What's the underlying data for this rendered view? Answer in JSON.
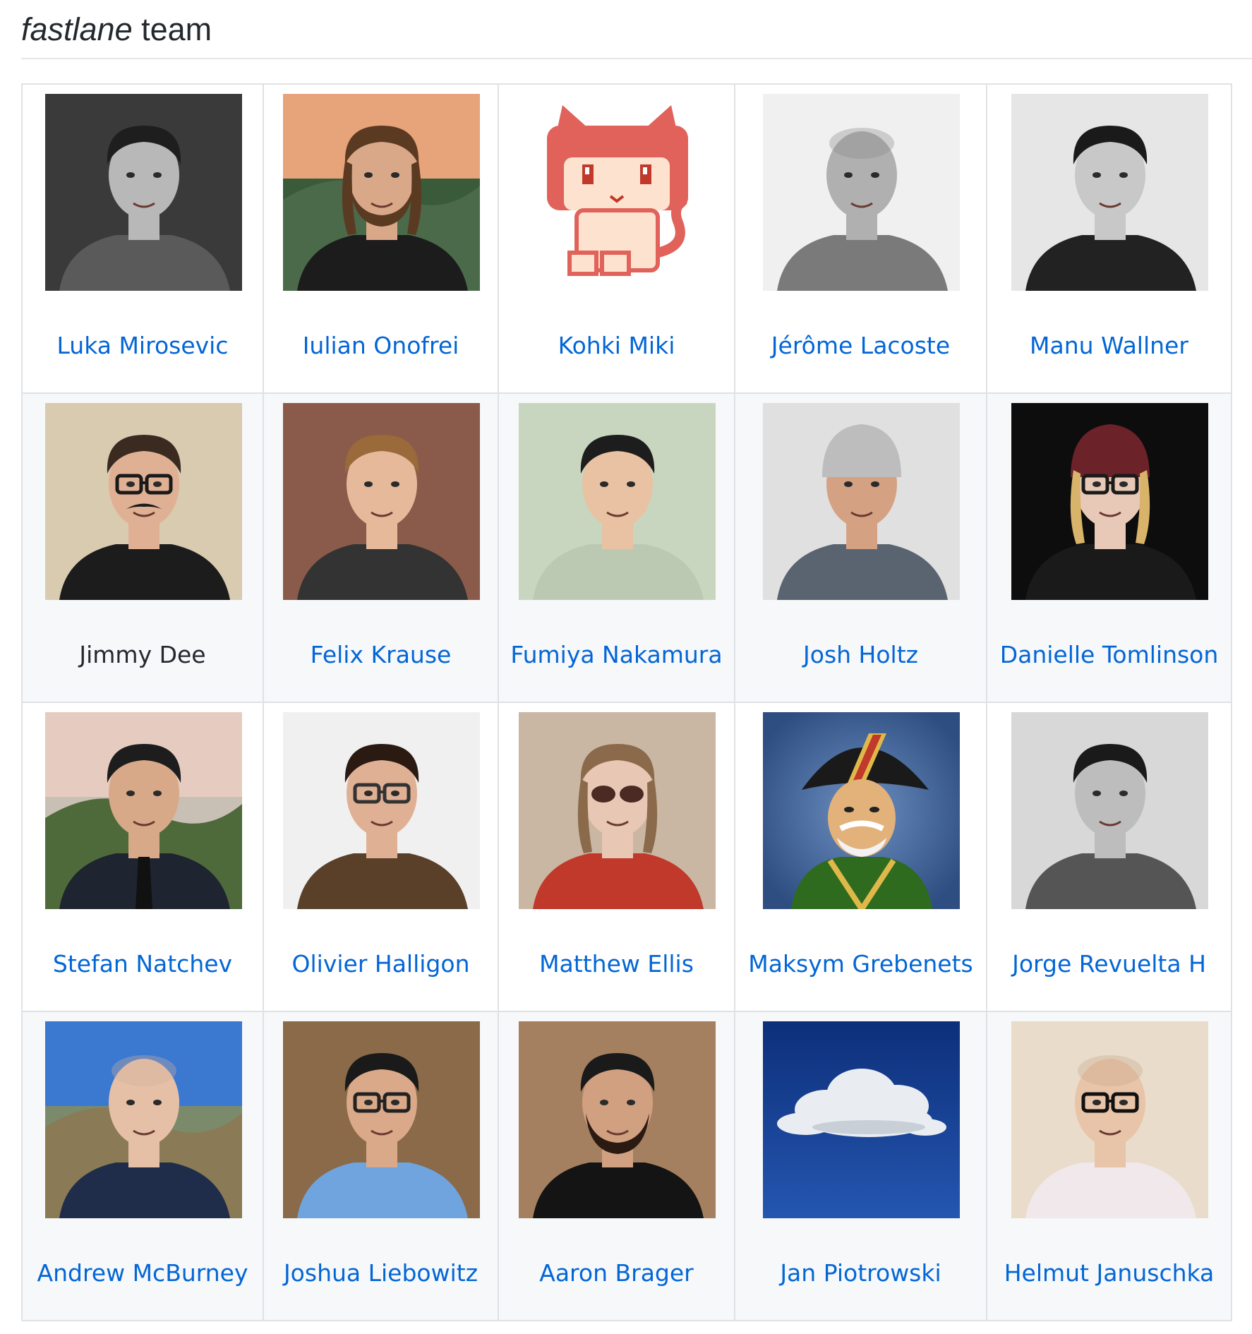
{
  "heading": {
    "emphasis": "fastlane",
    "rest": " team"
  },
  "colors": {
    "link": "#0366d6",
    "text": "#24292e",
    "border": "#dfe2e5",
    "stripe": "#f6f8fa"
  },
  "rows": [
    [
      {
        "name": "Luka Mirosevic",
        "link": true,
        "avatar_icon": "person-photo-icon"
      },
      {
        "name": "Iulian Onofrei",
        "link": true,
        "avatar_icon": "person-photo-icon"
      },
      {
        "name": "Kohki Miki",
        "link": true,
        "avatar_icon": "pixel-cat-icon"
      },
      {
        "name": "Jérôme Lacoste",
        "link": true,
        "avatar_icon": "person-photo-icon"
      },
      {
        "name": "Manu Wallner",
        "link": true,
        "avatar_icon": "person-photo-icon"
      }
    ],
    [
      {
        "name": "Jimmy Dee",
        "link": false,
        "avatar_icon": "person-photo-icon"
      },
      {
        "name": "Felix Krause",
        "link": true,
        "avatar_icon": "person-photo-icon"
      },
      {
        "name": "Fumiya Nakamura",
        "link": true,
        "avatar_icon": "person-photo-icon"
      },
      {
        "name": "Josh Holtz",
        "link": true,
        "avatar_icon": "person-photo-icon"
      },
      {
        "name": "Danielle Tomlinson",
        "link": true,
        "avatar_icon": "person-photo-icon"
      }
    ],
    [
      {
        "name": "Stefan Natchev",
        "link": true,
        "avatar_icon": "person-photo-icon"
      },
      {
        "name": "Olivier Halligon",
        "link": true,
        "avatar_icon": "person-photo-icon"
      },
      {
        "name": "Matthew Ellis",
        "link": true,
        "avatar_icon": "person-photo-icon"
      },
      {
        "name": "Maksym Grebenets",
        "link": true,
        "avatar_icon": "cartoon-general-icon"
      },
      {
        "name": "Jorge Revuelta H",
        "link": true,
        "avatar_icon": "person-photo-icon"
      }
    ],
    [
      {
        "name": "Andrew McBurney",
        "link": true,
        "avatar_icon": "person-photo-icon"
      },
      {
        "name": "Joshua Liebowitz",
        "link": true,
        "avatar_icon": "person-photo-icon"
      },
      {
        "name": "Aaron Brager",
        "link": true,
        "avatar_icon": "person-photo-icon"
      },
      {
        "name": "Jan Piotrowski",
        "link": true,
        "avatar_icon": "cloud-icon"
      },
      {
        "name": "Helmut Januschka",
        "link": true,
        "avatar_icon": "person-photo-icon"
      }
    ]
  ]
}
